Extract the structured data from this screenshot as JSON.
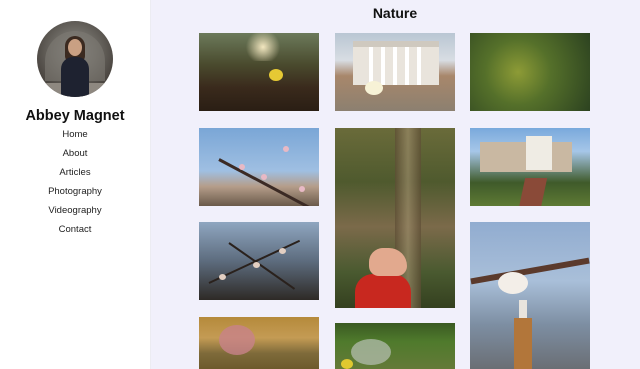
{
  "site": {
    "owner_name": "Abbey Magnet"
  },
  "nav": {
    "items": [
      "Home",
      "About",
      "Articles",
      "Photography",
      "Videography",
      "Contact"
    ]
  },
  "gallery": {
    "title": "Nature",
    "photo_count": 10
  },
  "colors": {
    "page_background": "#f1f0fb",
    "sidebar_background": "#ffffff",
    "text": "#111111"
  }
}
